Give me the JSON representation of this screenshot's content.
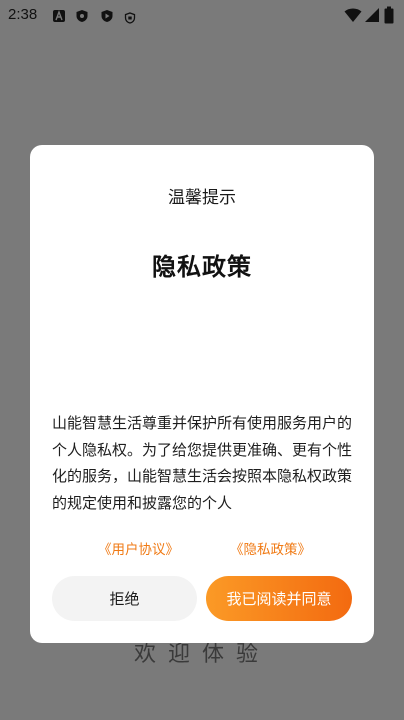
{
  "status_bar": {
    "time": "2:38",
    "icons": [
      "a-notification-icon",
      "shield-icon",
      "play-protect-icon",
      "small-shield-icon"
    ],
    "right_icons": [
      "wifi-icon",
      "cellular-signal-icon",
      "battery-icon"
    ]
  },
  "background": {
    "welcome_text": "欢迎体验"
  },
  "dialog": {
    "subtitle": "温馨提示",
    "title": "隐私政策",
    "body": "山能智慧生活尊重并保护所有使用服务用户的个人隐私权。为了给您提供更准确、更有个性化的服务，山能智慧生活会按照本隐私权政策的规定使用和披露您的个人",
    "links": {
      "user_agreement": "《用户协议》",
      "privacy_policy": "《隐私政策》"
    },
    "buttons": {
      "reject": "拒绝",
      "agree": "我已阅读并同意"
    }
  },
  "colors": {
    "accent": "#f07a14",
    "button_gradient_start": "#fb9a26",
    "button_gradient_end": "#f36a10",
    "overlay": "#7a7a7a"
  }
}
